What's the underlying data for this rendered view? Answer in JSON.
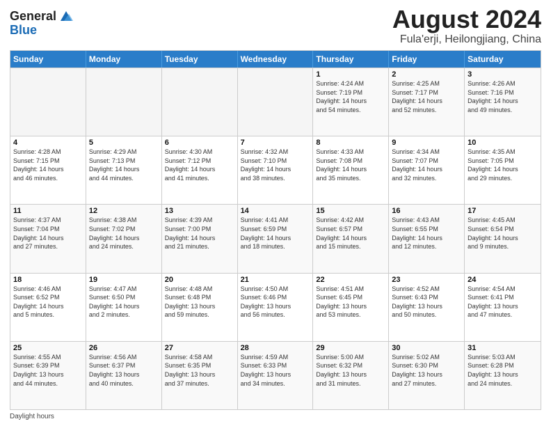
{
  "logo": {
    "line1": "General",
    "line2": "Blue"
  },
  "header": {
    "month": "August 2024",
    "location": "Fula'erji, Heilongjiang, China"
  },
  "weekdays": [
    "Sunday",
    "Monday",
    "Tuesday",
    "Wednesday",
    "Thursday",
    "Friday",
    "Saturday"
  ],
  "rows": [
    [
      {
        "day": "",
        "text": "",
        "empty": true
      },
      {
        "day": "",
        "text": "",
        "empty": true
      },
      {
        "day": "",
        "text": "",
        "empty": true
      },
      {
        "day": "",
        "text": "",
        "empty": true
      },
      {
        "day": "1",
        "text": "Sunrise: 4:24 AM\nSunset: 7:19 PM\nDaylight: 14 hours\nand 54 minutes."
      },
      {
        "day": "2",
        "text": "Sunrise: 4:25 AM\nSunset: 7:17 PM\nDaylight: 14 hours\nand 52 minutes."
      },
      {
        "day": "3",
        "text": "Sunrise: 4:26 AM\nSunset: 7:16 PM\nDaylight: 14 hours\nand 49 minutes."
      }
    ],
    [
      {
        "day": "4",
        "text": "Sunrise: 4:28 AM\nSunset: 7:15 PM\nDaylight: 14 hours\nand 46 minutes."
      },
      {
        "day": "5",
        "text": "Sunrise: 4:29 AM\nSunset: 7:13 PM\nDaylight: 14 hours\nand 44 minutes."
      },
      {
        "day": "6",
        "text": "Sunrise: 4:30 AM\nSunset: 7:12 PM\nDaylight: 14 hours\nand 41 minutes."
      },
      {
        "day": "7",
        "text": "Sunrise: 4:32 AM\nSunset: 7:10 PM\nDaylight: 14 hours\nand 38 minutes."
      },
      {
        "day": "8",
        "text": "Sunrise: 4:33 AM\nSunset: 7:08 PM\nDaylight: 14 hours\nand 35 minutes."
      },
      {
        "day": "9",
        "text": "Sunrise: 4:34 AM\nSunset: 7:07 PM\nDaylight: 14 hours\nand 32 minutes."
      },
      {
        "day": "10",
        "text": "Sunrise: 4:35 AM\nSunset: 7:05 PM\nDaylight: 14 hours\nand 29 minutes."
      }
    ],
    [
      {
        "day": "11",
        "text": "Sunrise: 4:37 AM\nSunset: 7:04 PM\nDaylight: 14 hours\nand 27 minutes."
      },
      {
        "day": "12",
        "text": "Sunrise: 4:38 AM\nSunset: 7:02 PM\nDaylight: 14 hours\nand 24 minutes."
      },
      {
        "day": "13",
        "text": "Sunrise: 4:39 AM\nSunset: 7:00 PM\nDaylight: 14 hours\nand 21 minutes."
      },
      {
        "day": "14",
        "text": "Sunrise: 4:41 AM\nSunset: 6:59 PM\nDaylight: 14 hours\nand 18 minutes."
      },
      {
        "day": "15",
        "text": "Sunrise: 4:42 AM\nSunset: 6:57 PM\nDaylight: 14 hours\nand 15 minutes."
      },
      {
        "day": "16",
        "text": "Sunrise: 4:43 AM\nSunset: 6:55 PM\nDaylight: 14 hours\nand 12 minutes."
      },
      {
        "day": "17",
        "text": "Sunrise: 4:45 AM\nSunset: 6:54 PM\nDaylight: 14 hours\nand 9 minutes."
      }
    ],
    [
      {
        "day": "18",
        "text": "Sunrise: 4:46 AM\nSunset: 6:52 PM\nDaylight: 14 hours\nand 5 minutes."
      },
      {
        "day": "19",
        "text": "Sunrise: 4:47 AM\nSunset: 6:50 PM\nDaylight: 14 hours\nand 2 minutes."
      },
      {
        "day": "20",
        "text": "Sunrise: 4:48 AM\nSunset: 6:48 PM\nDaylight: 13 hours\nand 59 minutes."
      },
      {
        "day": "21",
        "text": "Sunrise: 4:50 AM\nSunset: 6:46 PM\nDaylight: 13 hours\nand 56 minutes."
      },
      {
        "day": "22",
        "text": "Sunrise: 4:51 AM\nSunset: 6:45 PM\nDaylight: 13 hours\nand 53 minutes."
      },
      {
        "day": "23",
        "text": "Sunrise: 4:52 AM\nSunset: 6:43 PM\nDaylight: 13 hours\nand 50 minutes."
      },
      {
        "day": "24",
        "text": "Sunrise: 4:54 AM\nSunset: 6:41 PM\nDaylight: 13 hours\nand 47 minutes."
      }
    ],
    [
      {
        "day": "25",
        "text": "Sunrise: 4:55 AM\nSunset: 6:39 PM\nDaylight: 13 hours\nand 44 minutes."
      },
      {
        "day": "26",
        "text": "Sunrise: 4:56 AM\nSunset: 6:37 PM\nDaylight: 13 hours\nand 40 minutes."
      },
      {
        "day": "27",
        "text": "Sunrise: 4:58 AM\nSunset: 6:35 PM\nDaylight: 13 hours\nand 37 minutes."
      },
      {
        "day": "28",
        "text": "Sunrise: 4:59 AM\nSunset: 6:33 PM\nDaylight: 13 hours\nand 34 minutes."
      },
      {
        "day": "29",
        "text": "Sunrise: 5:00 AM\nSunset: 6:32 PM\nDaylight: 13 hours\nand 31 minutes."
      },
      {
        "day": "30",
        "text": "Sunrise: 5:02 AM\nSunset: 6:30 PM\nDaylight: 13 hours\nand 27 minutes."
      },
      {
        "day": "31",
        "text": "Sunrise: 5:03 AM\nSunset: 6:28 PM\nDaylight: 13 hours\nand 24 minutes."
      }
    ]
  ],
  "bottom_note": "Daylight hours"
}
